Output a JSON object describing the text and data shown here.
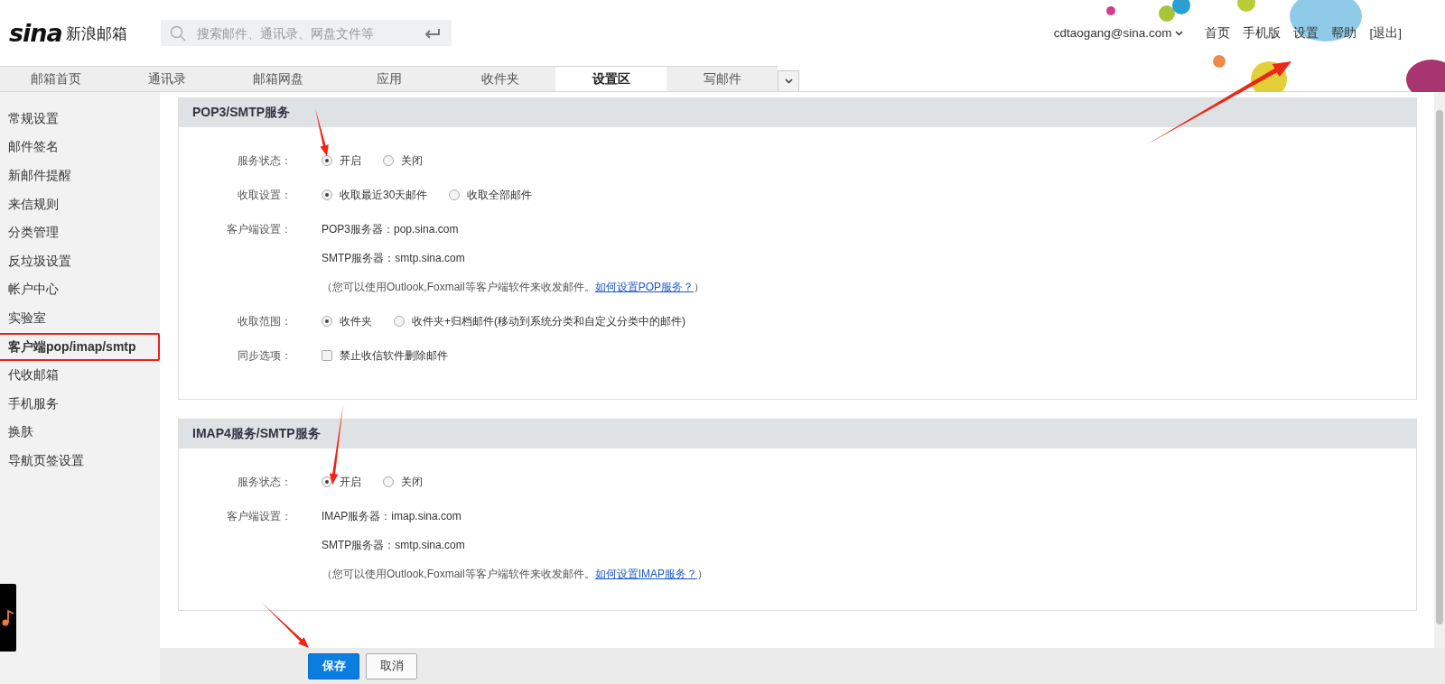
{
  "header": {
    "logo_text": "sina",
    "product": "新浪邮箱",
    "search": {
      "placeholder": "搜索邮件、通讯录、网盘文件等"
    },
    "account": "cdtaogang@sina.com",
    "links": [
      "首页",
      "手机版",
      "设置",
      "帮助",
      "[退出]"
    ]
  },
  "tabs": [
    {
      "label": "邮箱首页",
      "selected": false
    },
    {
      "label": "通讯录",
      "selected": false
    },
    {
      "label": "邮箱网盘",
      "selected": false
    },
    {
      "label": "应用",
      "selected": false
    },
    {
      "label": "收件夹",
      "selected": false
    },
    {
      "label": "设置区",
      "selected": true
    },
    {
      "label": "写邮件",
      "selected": false
    }
  ],
  "sidebar": {
    "items": [
      {
        "label": "常规设置",
        "selected": false,
        "highlighted": false
      },
      {
        "label": "邮件签名",
        "selected": false,
        "highlighted": false
      },
      {
        "label": "新邮件提醒",
        "selected": false,
        "highlighted": false
      },
      {
        "label": "来信规则",
        "selected": false,
        "highlighted": false
      },
      {
        "label": "分类管理",
        "selected": false,
        "highlighted": false
      },
      {
        "label": "反垃圾设置",
        "selected": false,
        "highlighted": false
      },
      {
        "label": "帐户中心",
        "selected": false,
        "highlighted": false
      },
      {
        "label": "实验室",
        "selected": false,
        "highlighted": false
      },
      {
        "label": "客户端pop/imap/smtp",
        "selected": true,
        "highlighted": true
      },
      {
        "label": "代收邮箱",
        "selected": false,
        "highlighted": false
      },
      {
        "label": "手机服务",
        "selected": false,
        "highlighted": false
      },
      {
        "label": "换肤",
        "selected": false,
        "highlighted": false
      },
      {
        "label": "导航页签设置",
        "selected": false,
        "highlighted": false
      }
    ]
  },
  "sections": [
    {
      "title": "POP3/SMTP服务",
      "rows": [
        {
          "kind": "radio",
          "label": "服务状态：",
          "options": [
            {
              "label": "开启",
              "selected": true
            },
            {
              "label": "关闭",
              "selected": false
            }
          ]
        },
        {
          "kind": "radio",
          "label": "收取设置：",
          "options": [
            {
              "label": "收取最近30天邮件",
              "selected": true
            },
            {
              "label": "收取全部邮件",
              "selected": false
            }
          ]
        },
        {
          "kind": "info",
          "label": "客户端设置：",
          "lines": [
            "POP3服务器：pop.sina.com",
            "SMTP服务器：smtp.sina.com"
          ],
          "note": {
            "before": "（您可以使用Outlook,Foxmail等客户端软件来收发邮件。",
            "link": "如何设置POP服务？",
            "after": "）"
          }
        },
        {
          "kind": "radio",
          "label": "收取范围：",
          "options": [
            {
              "label": "收件夹",
              "selected": true
            },
            {
              "label": "收件夹+归档邮件(移动到系统分类和自定义分类中的邮件)",
              "selected": false
            }
          ]
        },
        {
          "kind": "checkbox",
          "label": "同步选项：",
          "options": [
            {
              "label": "禁止收信软件删除邮件",
              "checked": false
            }
          ]
        }
      ]
    },
    {
      "title": "IMAP4服务/SMTP服务",
      "rows": [
        {
          "kind": "radio",
          "label": "服务状态：",
          "options": [
            {
              "label": "开启",
              "selected": true
            },
            {
              "label": "关闭",
              "selected": false
            }
          ]
        },
        {
          "kind": "info",
          "label": "客户端设置：",
          "lines": [
            "IMAP服务器：imap.sina.com",
            "SMTP服务器：smtp.sina.com"
          ],
          "note": {
            "before": "（您可以使用Outlook,Foxmail等客户端软件来收发邮件。",
            "link": "如何设置IMAP服务？",
            "after": "）"
          }
        }
      ]
    }
  ],
  "buttons": [
    {
      "label": "保存",
      "kind": "primary"
    },
    {
      "label": "取消",
      "kind": "default"
    }
  ]
}
